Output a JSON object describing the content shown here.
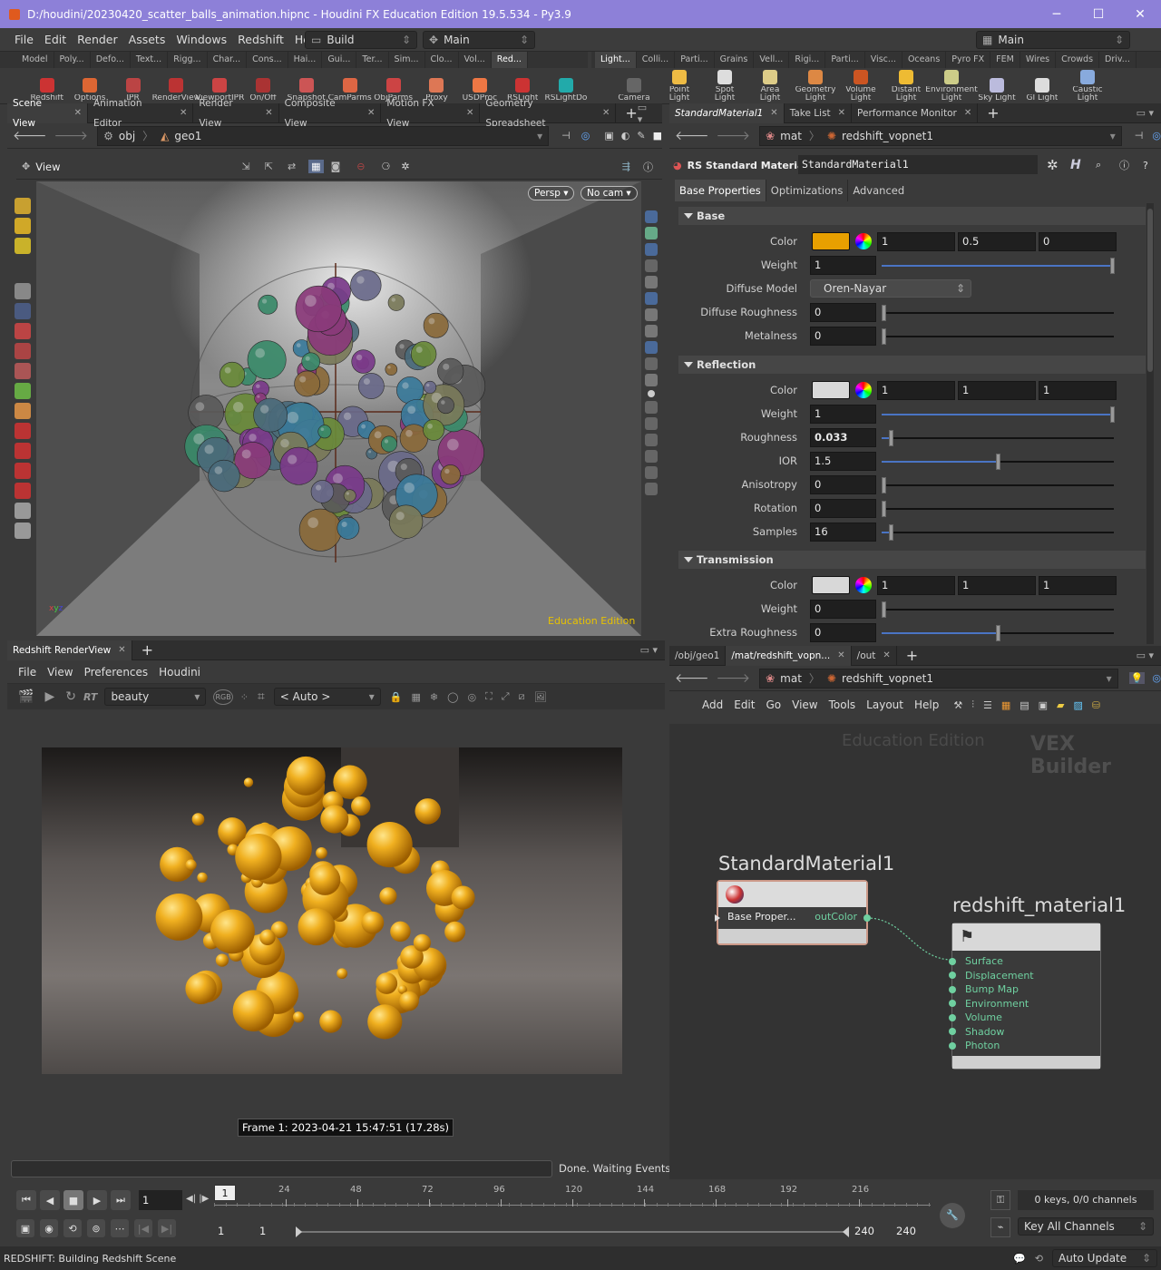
{
  "window": {
    "title": "D:/houdini/20230420_scatter_balls_animation.hipnc - Houdini FX Education Edition 19.5.534 - Py3.9",
    "minimize": "─",
    "maximize": "☐",
    "close": "✕"
  },
  "menu": {
    "items": [
      "File",
      "Edit",
      "Render",
      "Assets",
      "Windows",
      "Redshift",
      "Help"
    ],
    "desktop": "Build",
    "desktop_right": "Main",
    "main_right": "Main"
  },
  "shelf_left": {
    "tabs": [
      "Model",
      "Poly...",
      "Defo...",
      "Text...",
      "Rigg...",
      "Char...",
      "Cons...",
      "Hai...",
      "Gui...",
      "Ter...",
      "Sim...",
      "Clo...",
      "Vol...",
      "Red..."
    ],
    "tools": [
      "Redshift",
      "Options",
      "IPR",
      "RenderView",
      "ViewportIPR",
      "On/Off",
      "Snapshot",
      "CamParms",
      "ObjParms",
      "Proxy",
      "USDProc",
      "RSLight",
      "RSLightDo"
    ]
  },
  "shelf_right": {
    "tabs": [
      "Light...",
      "Colli...",
      "Parti...",
      "Grains",
      "Vell...",
      "Rigi...",
      "Parti...",
      "Visc...",
      "Oceans",
      "Pyro FX",
      "FEM",
      "Wires",
      "Crowds",
      "Driv..."
    ],
    "tools": [
      "Camera",
      "Point Light",
      "Spot Light",
      "Area Light",
      "Geometry Light",
      "Volume Light",
      "Distant Light",
      "Environment Light",
      "Sky Light",
      "GI Light",
      "Caustic Light"
    ]
  },
  "scene_pane": {
    "tabs": [
      "Scene View",
      "Animation Editor",
      "Render View",
      "Composite View",
      "Motion FX View",
      "Geometry Spreadsheet"
    ],
    "path": [
      "obj",
      "geo1"
    ],
    "view_label": "View",
    "persp": "Persp ▾",
    "cam": "No cam ▾",
    "watermark": "Education Edition"
  },
  "param_pane": {
    "tabs": [
      "StandardMaterial1",
      "Take List",
      "Performance Monitor"
    ],
    "path": [
      "mat",
      "redshift_vopnet1"
    ],
    "node_type": "RS Standard Material",
    "node_name": "StandardMaterial1",
    "subtabs": [
      "Base Properties",
      "Optimizations",
      "Advanced"
    ],
    "sections": {
      "base": "Base",
      "reflection": "Reflection",
      "transmission": "Transmission"
    },
    "base_color": {
      "label": "Color",
      "r": "1",
      "g": "0.5",
      "b": "0",
      "swatch": "#e8a000"
    },
    "base_weight": {
      "label": "Weight",
      "value": "1",
      "fraction": 1.0
    },
    "diffuse_model": {
      "label": "Diffuse Model",
      "value": "Oren-Nayar"
    },
    "diffuse_roughness": {
      "label": "Diffuse Roughness",
      "value": "0",
      "fraction": 0.0
    },
    "metalness": {
      "label": "Metalness",
      "value": "0",
      "fraction": 0.0
    },
    "refl_color": {
      "label": "Color",
      "r": "1",
      "g": "1",
      "b": "1",
      "swatch": "#d8d8d8"
    },
    "refl_weight": {
      "label": "Weight",
      "value": "1",
      "fraction": 1.0
    },
    "refl_roughness": {
      "label": "Roughness",
      "value": "0.033",
      "fraction": 0.033
    },
    "refl_ior": {
      "label": "IOR",
      "value": "1.5",
      "fraction": 0.5
    },
    "refl_anisotropy": {
      "label": "Anisotropy",
      "value": "0",
      "fraction": 0.0
    },
    "refl_rotation": {
      "label": "Rotation",
      "value": "0",
      "fraction": 0.0
    },
    "refl_samples": {
      "label": "Samples",
      "value": "16",
      "fraction": 0.03
    },
    "trans_color": {
      "label": "Color",
      "r": "1",
      "g": "1",
      "b": "1",
      "swatch": "#d8d8d8"
    },
    "trans_weight": {
      "label": "Weight",
      "value": "0",
      "fraction": 0.0
    },
    "trans_extra_roughness": {
      "label": "Extra Roughness",
      "value": "0",
      "fraction": 0.5
    }
  },
  "renderview": {
    "tab": "Redshift RenderView",
    "menu": [
      "File",
      "View",
      "Preferences",
      "Houdini"
    ],
    "rt": "RT",
    "aov": "beauty",
    "rgb": "RGB",
    "zoom": "< Auto >",
    "frame_info": "Frame 1:  2023-04-21  15:47:51  (17.28s)",
    "status": "Done. Waiting Events"
  },
  "network_pane": {
    "tabs": [
      "/obj/geo1",
      "/mat/redshift_vopn...",
      "/out"
    ],
    "path": [
      "mat",
      "redshift_vopnet1"
    ],
    "menu": [
      "Add",
      "Edit",
      "Go",
      "View",
      "Tools",
      "Layout",
      "Help"
    ],
    "watermark": "Education Edition",
    "context": "VEX Builder",
    "node1": {
      "name": "StandardMaterial1",
      "input": "Base Proper...",
      "output": "outColor"
    },
    "node2": {
      "name": "redshift_material1",
      "ports": [
        "Surface",
        "Displacement",
        "Bump Map",
        "Environment",
        "Volume",
        "Shadow",
        "Photon"
      ]
    }
  },
  "timeline": {
    "frame": "1",
    "current": "1",
    "ticks": [
      "24",
      "48",
      "72",
      "96",
      "120",
      "144",
      "168",
      "192",
      "216"
    ],
    "start": "1",
    "start2": "1",
    "end": "240",
    "end2": "240",
    "keys": "0 keys, 0/0 channels",
    "key_all": "Key All Channels"
  },
  "status": {
    "message": "REDSHIFT: Building Redshift Scene",
    "update": "Auto Update"
  }
}
